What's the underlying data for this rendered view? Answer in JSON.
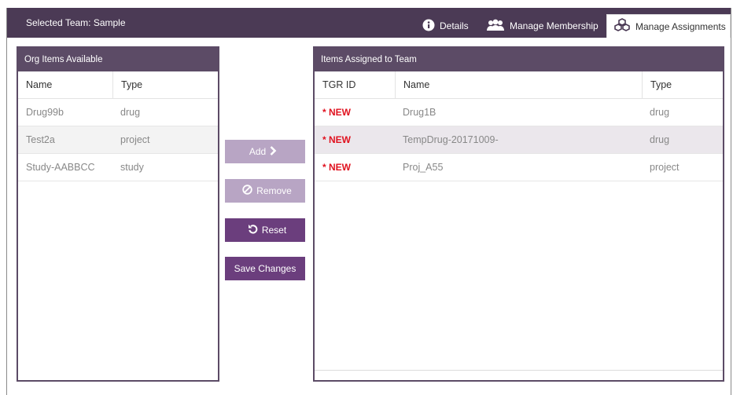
{
  "header": {
    "title": "Selected Team: Sample",
    "tabs": [
      {
        "label": "Details",
        "icon": "info-icon"
      },
      {
        "label": "Manage Membership",
        "icon": "people-icon"
      },
      {
        "label": "Manage Assignments",
        "icon": "cubes-icon",
        "active": true
      }
    ]
  },
  "left_panel": {
    "title": "Org Items Available",
    "columns": [
      "Name",
      "Type"
    ],
    "rows": [
      {
        "name": "Drug99b",
        "type": "drug"
      },
      {
        "name": "Test2a",
        "type": "project"
      },
      {
        "name": "Study-AABBCC",
        "type": "study"
      }
    ]
  },
  "actions": {
    "add": "Add",
    "remove": "Remove",
    "reset": "Reset",
    "save": "Save Changes"
  },
  "right_panel": {
    "title": "Items Assigned to Team",
    "columns": [
      "TGR ID",
      "Name",
      "Type"
    ],
    "rows": [
      {
        "tgr_id": "* NEW",
        "name": "Drug1B",
        "type": "drug"
      },
      {
        "tgr_id": "* NEW",
        "name": "TempDrug-20171009-",
        "type": "drug"
      },
      {
        "tgr_id": "* NEW",
        "name": "Proj_A55",
        "type": "project"
      }
    ]
  },
  "colors": {
    "header_bg": "#4b3a55",
    "panel_header": "#5c4b66",
    "button_disabled": "#b8a5c4",
    "button_active": "#6b3e7d",
    "new_marker": "#e0121f"
  }
}
